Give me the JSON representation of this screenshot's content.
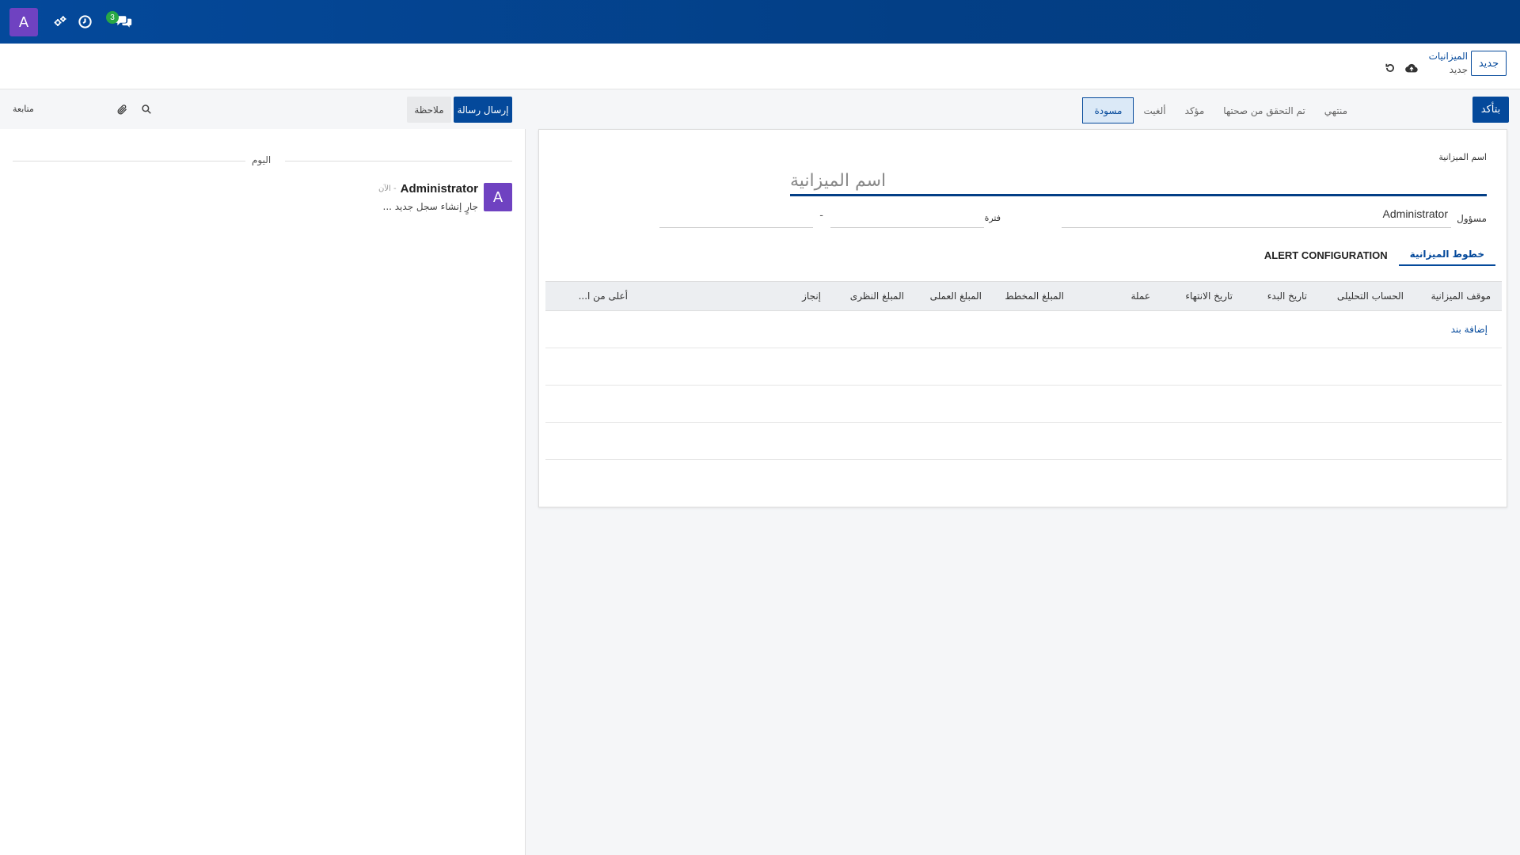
{
  "topbar": {
    "avatar_letter": "A",
    "messages_badge": "3",
    "icons": [
      "avatar",
      "settings-gear-icon",
      "clock-icon",
      "chat-icon"
    ]
  },
  "control": {
    "breadcrumb_parent": "الميزانيات",
    "breadcrumb_current": "جديد",
    "new_label": "جديد"
  },
  "status": {
    "confirm_label": "بتأكد",
    "stages": [
      {
        "label": "مسودة",
        "active": true
      },
      {
        "label": "ألغيت",
        "active": false
      },
      {
        "label": "مؤكد",
        "active": false
      },
      {
        "label": "تم التحقق من صحتها",
        "active": false
      },
      {
        "label": "منتهي",
        "active": false
      }
    ]
  },
  "form": {
    "name_label": "اسم الميزانية",
    "name_placeholder": "اسم الميزانية",
    "responsible_label": "مسؤول",
    "responsible_value": "Administrator",
    "period_label": "فترة",
    "period_separator": "-",
    "tabs": [
      {
        "label": "خطوط الميزانية",
        "active": true
      },
      {
        "label": "ALERT CONFIGURATION",
        "active": false
      }
    ],
    "columns": [
      "موقف الميزانية",
      "الحساب التحليلى",
      "تاريخ البدء",
      "تاريخ الانتهاء",
      "عملة",
      "المبلغ المخطط",
      "المبلغ العملى",
      "المبلغ النظرى",
      "إنجاز",
      "أعلى من ا..."
    ],
    "add_line_label": "إضافة بند"
  },
  "chatter": {
    "send_label": "إرسال رسالة",
    "note_label": "ملاحظة",
    "follow_label": "متابعة",
    "separator_label": "اليوم",
    "message": {
      "avatar_letter": "A",
      "author": "Administrator",
      "time": "- الآن",
      "body": "جارٍ إنشاء سجل جديد ..."
    }
  },
  "colors": {
    "brand": "#04499b",
    "avatar": "#6f42c1",
    "badge": "#28a745"
  }
}
